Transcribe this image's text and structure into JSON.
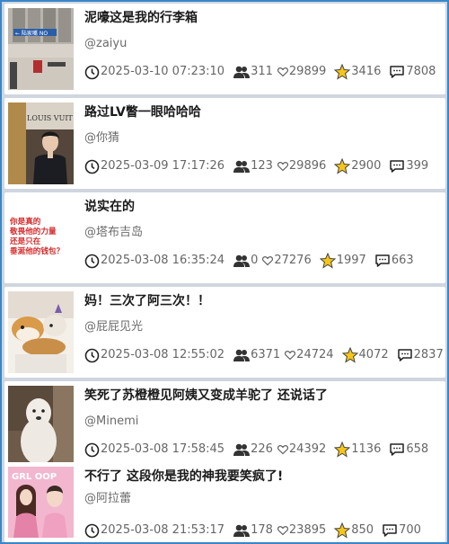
{
  "posts": [
    {
      "title": "泥嚎这是我的行李箱",
      "author": "@zaiyu",
      "time": "2025-03-10 07:23:10",
      "users": "311",
      "likes": "29899",
      "stars": "3416",
      "comments": "7808",
      "thumb": "street-building-photo",
      "thumb_text": "← 陆家嘴 NO"
    },
    {
      "title": "路过LV瞥一眼哈哈哈",
      "author": "@你猜",
      "time": "2025-03-09 17:17:26",
      "users": "123",
      "likes": "29896",
      "stars": "2900",
      "comments": "399",
      "thumb": "man-at-store-photo",
      "thumb_text": "LOUIS VUIT"
    },
    {
      "title": "说实在的",
      "author": "@塔布吉岛",
      "time": "2025-03-08 16:35:24",
      "users": "0",
      "likes": "27276",
      "stars": "1997",
      "comments": "663",
      "thumb": "red-text-image",
      "thumb_lines": [
        "你是真的",
        "敬畏他的力量",
        "还是只在",
        "垂涎他的钱包？"
      ]
    },
    {
      "title": "妈！三次了阿三次！！",
      "author": "@屁屁见光",
      "time": "2025-03-08 12:55:02",
      "users": "6371",
      "likes": "24724",
      "stars": "4072",
      "comments": "2837",
      "thumb": "hamster-photo"
    },
    {
      "title": "笑死了苏橙橙见阿姨又变成羊驼了 还说话了",
      "author": "@Minemi",
      "time": "2025-03-08 17:58:45",
      "users": "226",
      "likes": "24392",
      "stars": "1136",
      "comments": "658",
      "thumb": "alpaca-dog-photo"
    },
    {
      "title": "不行了 这段你是我的神我要笑疯了!",
      "author": "@阿拉蕾",
      "time": "2025-03-08 21:53:17",
      "users": "178",
      "likes": "23895",
      "stars": "850",
      "comments": "700",
      "thumb": "two-people-pink-photo",
      "thumb_text": "GRL OOP"
    }
  ],
  "colors": {
    "frame": "#3a86c8",
    "star": "#f5c518",
    "thumb_red_text": "#d42a2a"
  }
}
